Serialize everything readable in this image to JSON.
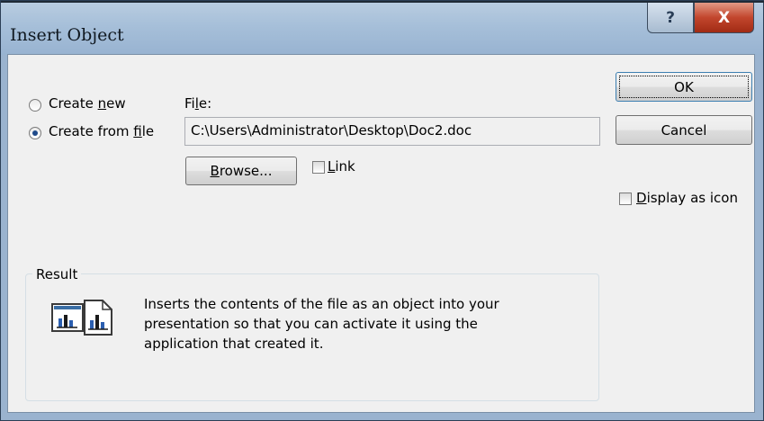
{
  "window": {
    "title": "Insert Object",
    "help_glyph": "?",
    "close_glyph": "X"
  },
  "options": {
    "create_new": {
      "pre": "Create ",
      "accel": "n",
      "post": "ew"
    },
    "create_from_file": {
      "pre": "Create from ",
      "accel": "f",
      "post": "ile",
      "selected": true
    }
  },
  "file": {
    "label_pre": "Fi",
    "label_accel": "l",
    "label_post": "e:",
    "value": "C:\\Users\\Administrator\\Desktop\\Doc2.doc"
  },
  "browse": {
    "accel": "B",
    "post": "rowse..."
  },
  "link": {
    "accel": "L",
    "post": "ink",
    "checked": false
  },
  "buttons": {
    "ok": "OK",
    "cancel": "Cancel"
  },
  "display_as_icon": {
    "accel": "D",
    "post": "isplay as icon",
    "checked": false
  },
  "result": {
    "legend": "Result",
    "line1": "Inserts the contents of the file as an object into your",
    "line2": "presentation so that you can activate it using the",
    "line3": "application that created it."
  },
  "icons": {
    "result": "embedded-file-chart-icon"
  }
}
